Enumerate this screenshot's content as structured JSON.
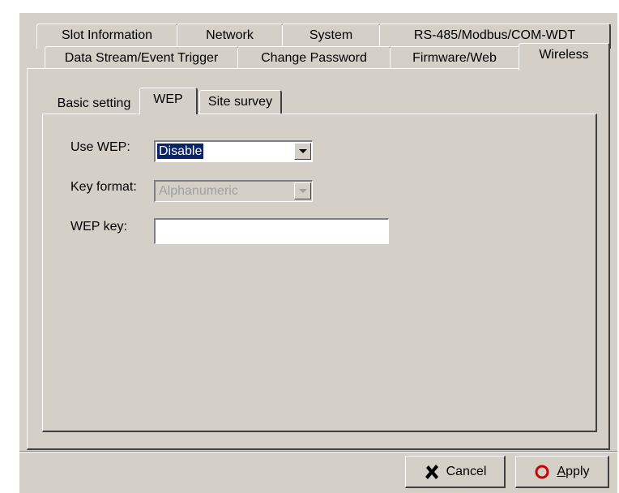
{
  "tabs_row1": [
    {
      "label": "Slot Information"
    },
    {
      "label": "Network"
    },
    {
      "label": "System"
    },
    {
      "label": "RS-485/Modbus/COM-WDT"
    }
  ],
  "tabs_row2": [
    {
      "label": "Data Stream/Event Trigger"
    },
    {
      "label": "Change Password"
    },
    {
      "label": "Firmware/Web"
    },
    {
      "label": "Wireless",
      "selected": true
    }
  ],
  "subtabs": [
    {
      "label": "Basic setting"
    },
    {
      "label": "WEP",
      "selected": true
    },
    {
      "label": "Site survey"
    }
  ],
  "form": {
    "use_wep_label": "Use WEP:",
    "use_wep_value": "Disable",
    "key_format_label": "Key format:",
    "key_format_value": "Alphanumeric",
    "key_format_disabled": true,
    "wep_key_label": "WEP key:",
    "wep_key_value": ""
  },
  "buttons": {
    "cancel_label": "Cancel",
    "apply_first": "A",
    "apply_rest": "pply"
  },
  "colors": {
    "face": "#d4d0c8",
    "selection": "#0a246a",
    "cancel_icon": "#000000",
    "apply_icon": "#cc0000"
  }
}
